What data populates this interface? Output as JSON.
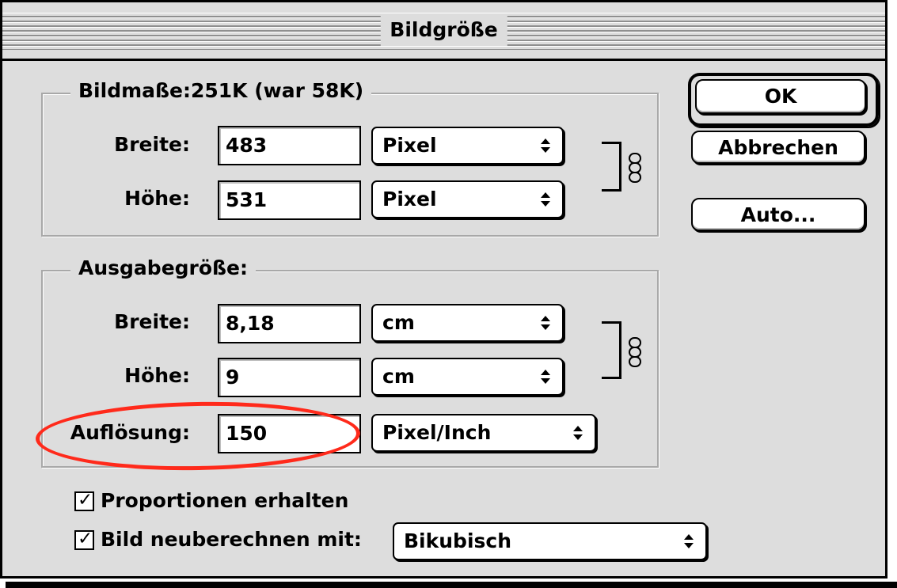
{
  "window": {
    "title": "Bildgröße"
  },
  "pixel_dimensions": {
    "title": "Bildmaße:251K (war 58K)",
    "width_label": "Breite:",
    "width_value": "483",
    "width_unit": "Pixel",
    "height_label": "Höhe:",
    "height_value": "531",
    "height_unit": "Pixel"
  },
  "output_size": {
    "title": "Ausgabegröße:",
    "width_label": "Breite:",
    "width_value": "8,18",
    "width_unit": "cm",
    "height_label": "Höhe:",
    "height_value": "9",
    "height_unit": "cm",
    "resolution_label": "Auflösung:",
    "resolution_value": "150",
    "resolution_unit": "Pixel/Inch"
  },
  "buttons": {
    "ok": "OK",
    "cancel": "Abbrechen",
    "auto": "Auto..."
  },
  "options": {
    "constrain_label": "Proportionen erhalten",
    "resample_label": "Bild neuberechnen mit:",
    "resample_method": "Bikubisch"
  },
  "icons": {
    "chain": "chain-link-icon",
    "popup_arrows": "up-down-arrows-icon",
    "checkmark": "checkmark-icon"
  },
  "colors": {
    "highlight": "#ff2a1b",
    "dialog_bg": "#dddddd"
  }
}
